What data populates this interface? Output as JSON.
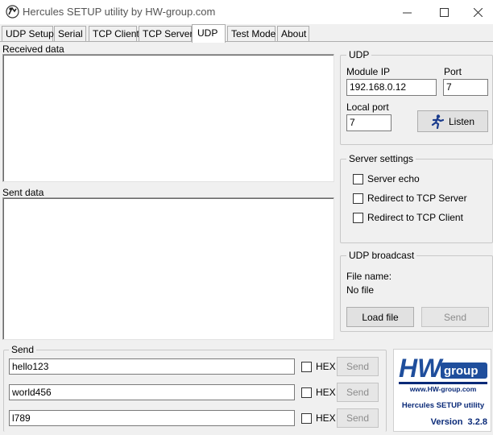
{
  "window": {
    "title": "Hercules SETUP utility by HW-group.com",
    "icons": {
      "app": "hercules-icon",
      "minimize": "minimize-icon",
      "maximize": "maximize-icon",
      "close": "close-icon"
    }
  },
  "tabs": [
    {
      "label": "UDP Setup"
    },
    {
      "label": "Serial"
    },
    {
      "label": "TCP Client"
    },
    {
      "label": "TCP Server"
    },
    {
      "label": "UDP",
      "active": true
    },
    {
      "label": "Test Mode"
    },
    {
      "label": "About"
    }
  ],
  "received": {
    "label": "Received data"
  },
  "sent": {
    "label": "Sent data"
  },
  "udp": {
    "group_title": "UDP",
    "module_ip_label": "Module IP",
    "module_ip_value": "192.168.0.12",
    "port_label": "Port",
    "port_value": "7",
    "local_port_label": "Local port",
    "local_port_value": "7",
    "listen_label": "Listen"
  },
  "server_settings": {
    "group_title": "Server settings",
    "options": [
      {
        "label": "Server echo",
        "checked": false
      },
      {
        "label": "Redirect to TCP Server",
        "checked": false
      },
      {
        "label": "Redirect to TCP Client",
        "checked": false
      }
    ]
  },
  "broadcast": {
    "group_title": "UDP broadcast",
    "file_name_label": "File name:",
    "file_name_value": "No file",
    "load_label": "Load file",
    "send_label": "Send"
  },
  "send": {
    "group_title": "Send",
    "rows": [
      {
        "value": "hello123",
        "hex_label": "HEX",
        "send_label": "Send"
      },
      {
        "value": "world456",
        "hex_label": "HEX",
        "send_label": "Send"
      },
      {
        "value": "l789",
        "hex_label": "HEX",
        "send_label": "Send"
      }
    ]
  },
  "logo": {
    "brand": "HW",
    "brand_suffix": "group",
    "url": "www.HW-group.com",
    "product": "Hercules SETUP utility",
    "version": "Version  3.2.8",
    "colors": {
      "brand_blue": "#1f4e9c",
      "text_blue": "#0a2a78"
    }
  }
}
